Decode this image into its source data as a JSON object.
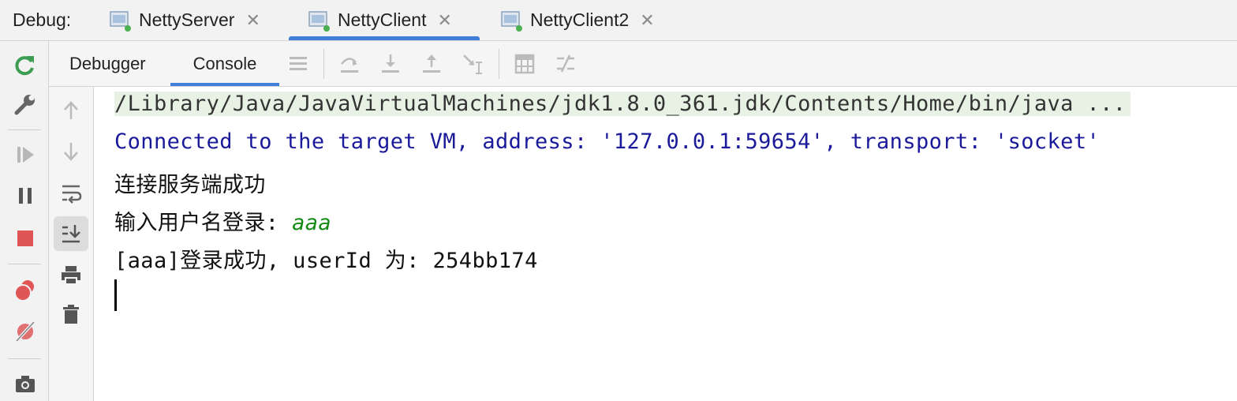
{
  "debug_bar": {
    "label": "Debug:",
    "tabs": [
      {
        "title": "NettyServer",
        "active": false
      },
      {
        "title": "NettyClient",
        "active": true
      },
      {
        "title": "NettyClient2",
        "active": false
      }
    ]
  },
  "subtabs": [
    {
      "label": "Debugger",
      "active": false
    },
    {
      "label": "Console",
      "active": true
    }
  ],
  "left_toolbar_icons": [
    "rerun-icon",
    "wrench-icon",
    "resume-icon",
    "pause-icon",
    "stop-icon",
    "view-breakpoints-icon",
    "mute-breakpoints-icon",
    "camera-icon"
  ],
  "toolbar_icons": [
    "menu-icon",
    "step-over-icon",
    "step-into-icon",
    "step-out-icon",
    "run-to-cursor-icon",
    "evaluate-expression-icon",
    "trace-icon"
  ],
  "gutter_icons": [
    "up-arrow-icon",
    "down-arrow-icon",
    "soft-wrap-icon",
    "scroll-to-end-icon",
    "print-icon",
    "trash-icon"
  ],
  "console": {
    "command_line": "/Library/Java/JavaVirtualMachines/jdk1.8.0_361.jdk/Contents/Home/bin/java ...",
    "connected_line": "Connected to the target VM, address: '127.0.0.1:59654', transport: 'socket'",
    "line_connect_success": "连接服务端成功",
    "prompt_text": "输入用户名登录: ",
    "prompt_input": "aaa",
    "login_result": "[aaa]登录成功, userId 为: 254bb174"
  },
  "colors": {
    "accent": "#3f7fd8",
    "system_text": "#1b1a9a",
    "user_input": "#138a13",
    "stop_red": "#e05555",
    "run_green": "#3d9e53"
  }
}
